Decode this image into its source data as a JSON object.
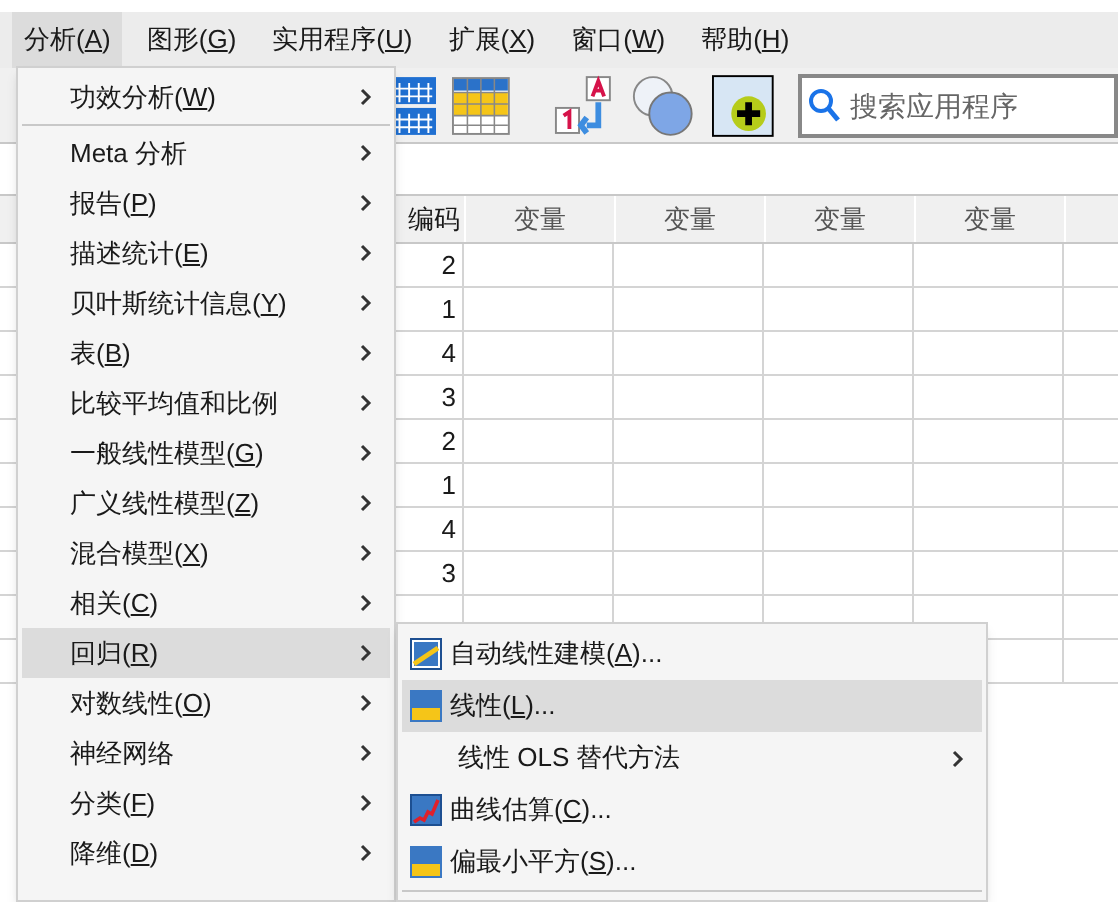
{
  "menu_bar": [
    {
      "text": "分析(A)",
      "selected": true
    },
    {
      "text": "图形(G)",
      "selected": false
    },
    {
      "text": "实用程序(U)",
      "selected": false
    },
    {
      "text": "扩展(X)",
      "selected": false
    },
    {
      "text": "窗口(W)",
      "selected": false
    },
    {
      "text": "帮助(H)",
      "selected": false
    }
  ],
  "search": {
    "placeholder": "搜索应用程序"
  },
  "grid": {
    "columns": [
      "编码",
      "变量",
      "变量",
      "变量",
      "变量"
    ],
    "rows": [
      "2",
      "1",
      "4",
      "3",
      "2",
      "1",
      "4",
      "3"
    ]
  },
  "analyze_menu": [
    {
      "text": "功效分析(W)",
      "submenu": true,
      "selected": false,
      "separator_after": true
    },
    {
      "text": "Meta 分析",
      "submenu": true,
      "selected": false
    },
    {
      "text": "报告(P)",
      "submenu": true,
      "selected": false
    },
    {
      "text": "描述统计(E)",
      "submenu": true,
      "selected": false
    },
    {
      "text": "贝叶斯统计信息(Y)",
      "submenu": true,
      "selected": false
    },
    {
      "text": "表(B)",
      "submenu": true,
      "selected": false
    },
    {
      "text": "比较平均值和比例",
      "submenu": true,
      "selected": false
    },
    {
      "text": "一般线性模型(G)",
      "submenu": true,
      "selected": false
    },
    {
      "text": "广义线性模型(Z)",
      "submenu": true,
      "selected": false
    },
    {
      "text": "混合模型(X)",
      "submenu": true,
      "selected": false
    },
    {
      "text": "相关(C)",
      "submenu": true,
      "selected": false
    },
    {
      "text": "回归(R)",
      "submenu": true,
      "selected": true
    },
    {
      "text": "对数线性(O)",
      "submenu": true,
      "selected": false
    },
    {
      "text": "神经网络",
      "submenu": true,
      "selected": false
    },
    {
      "text": "分类(F)",
      "submenu": true,
      "selected": false
    },
    {
      "text": "降维(D)",
      "submenu": true,
      "selected": false
    }
  ],
  "regression_menu": [
    {
      "text": "自动线性建模(A)...",
      "kind": "auto",
      "submenu": false,
      "selected": false
    },
    {
      "text": "线性(L)...",
      "kind": "lin",
      "submenu": false,
      "selected": true
    },
    {
      "text": "线性 OLS 替代方法",
      "kind": "plain",
      "submenu": true,
      "selected": false
    },
    {
      "text": "曲线估算(C)...",
      "kind": "curve",
      "submenu": false,
      "selected": false
    },
    {
      "text": "偏最小平方(S)...",
      "kind": "pls",
      "submenu": false,
      "selected": false,
      "separator_after": true
    }
  ]
}
